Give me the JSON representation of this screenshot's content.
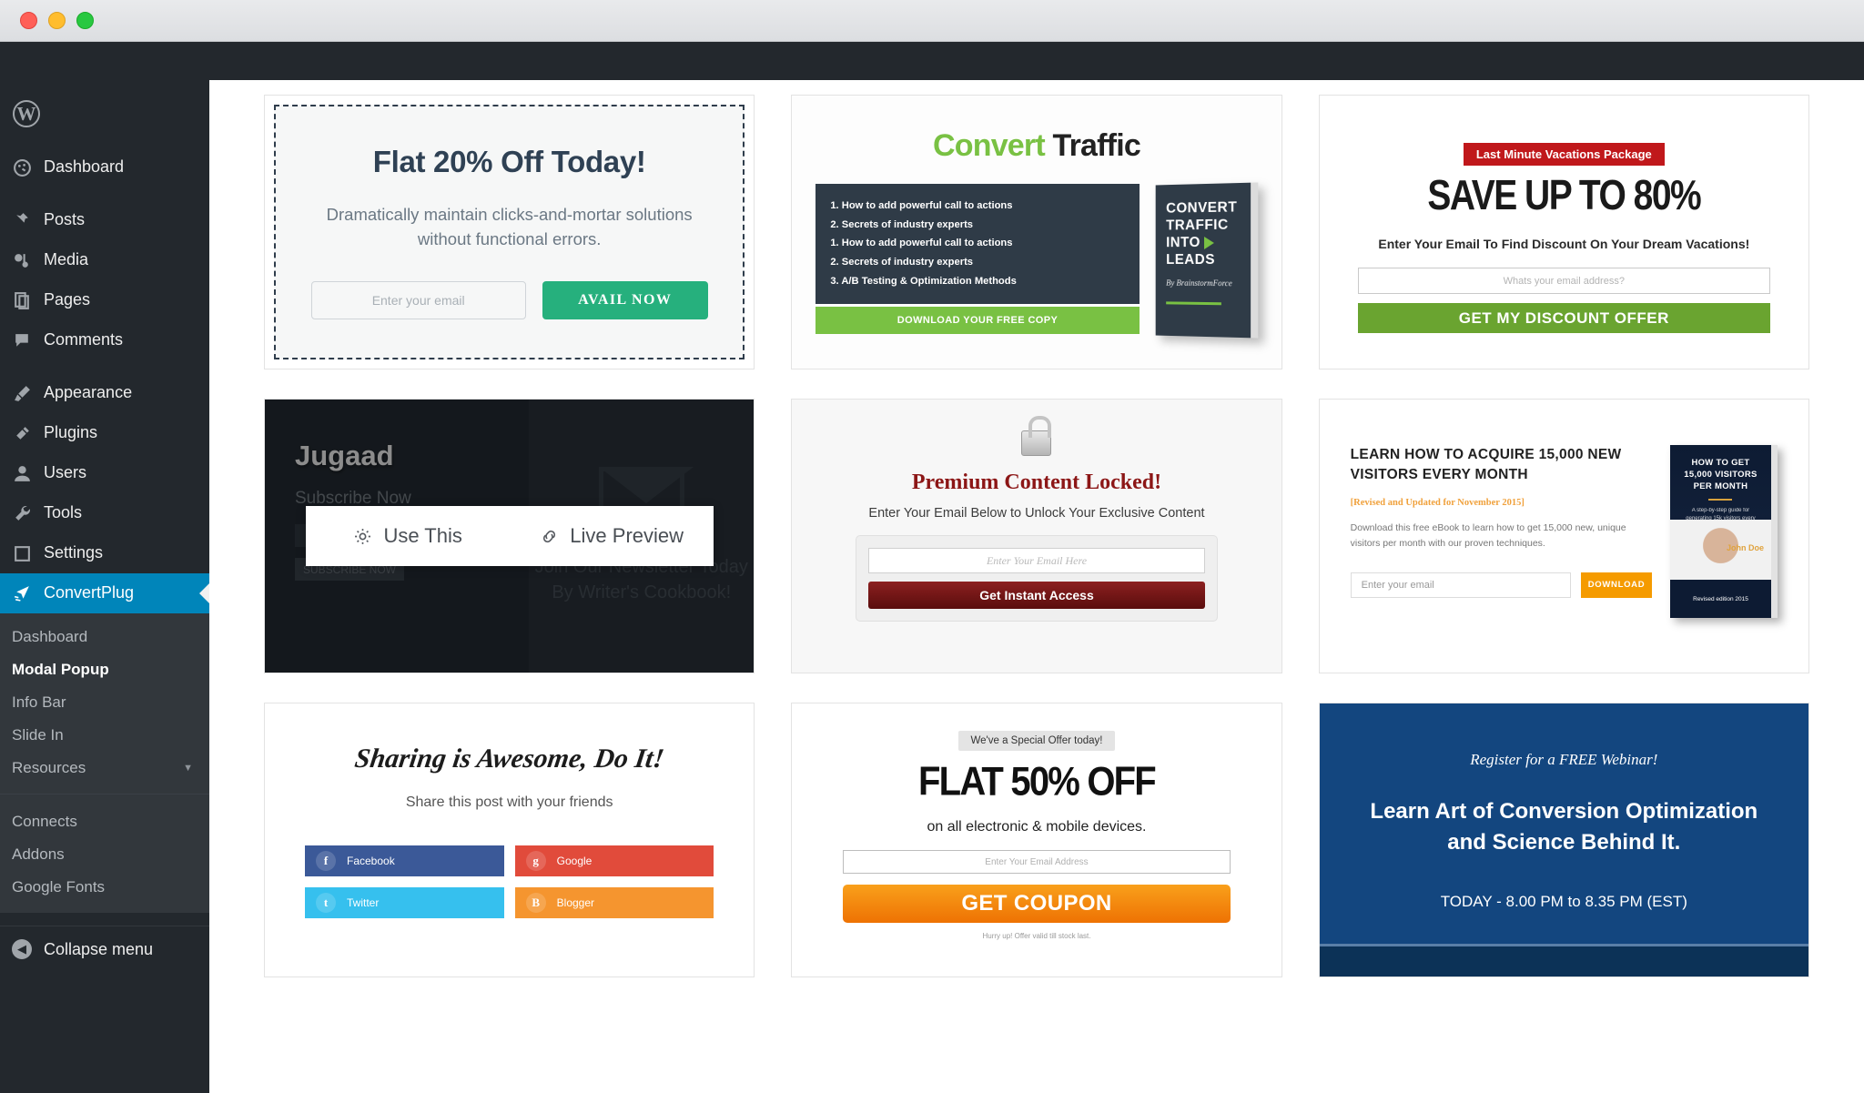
{
  "window": {
    "title": ""
  },
  "sidebar": {
    "logo": "W",
    "items": [
      {
        "label": "Dashboard",
        "icon": "dashboard-icon"
      },
      {
        "label": "Posts",
        "icon": "pin-icon"
      },
      {
        "label": "Media",
        "icon": "media-icon"
      },
      {
        "label": "Pages",
        "icon": "pages-icon"
      },
      {
        "label": "Comments",
        "icon": "comments-icon"
      },
      {
        "label": "Appearance",
        "icon": "brush-icon"
      },
      {
        "label": "Plugins",
        "icon": "plug-icon"
      },
      {
        "label": "Users",
        "icon": "user-icon"
      },
      {
        "label": "Tools",
        "icon": "wrench-icon"
      },
      {
        "label": "Settings",
        "icon": "settings-icon"
      },
      {
        "label": "ConvertPlug",
        "icon": "convertplug-icon"
      }
    ],
    "submenu": [
      {
        "label": "Dashboard",
        "current": false
      },
      {
        "label": "Modal Popup",
        "current": true
      },
      {
        "label": "Info Bar",
        "current": false
      },
      {
        "label": "Slide In",
        "current": false
      },
      {
        "label": "Resources",
        "current": false,
        "caret": "▼"
      }
    ],
    "submenu2": [
      {
        "label": "Connects"
      },
      {
        "label": "Addons"
      },
      {
        "label": "Google Fonts"
      }
    ],
    "collapse": {
      "label": "Collapse menu",
      "icon": "collapse-icon",
      "glyph": "◀"
    },
    "accent_color": "#0085ba",
    "bg_color": "#23282d",
    "submenu_bg": "#32373c"
  },
  "overlay": {
    "use_this": "Use This",
    "live_preview": "Live Preview",
    "use_this_icon": "gear-icon",
    "live_preview_icon": "link-icon"
  },
  "templates": {
    "flat20": {
      "title": "Flat 20% Off Today!",
      "body": "Dramatically maintain clicks-and-mortar solutions without functional errors.",
      "input_placeholder": "Enter your email",
      "button": "AVAIL NOW",
      "button_color": "#26b07d",
      "title_color": "#2f4154"
    },
    "convert": {
      "title_green": "Convert",
      "title_dark": " Traffic",
      "list": [
        "1. How to add powerful call to actions",
        "2. Secrets of industry experts",
        "1. How to add powerful call to actions",
        "2. Secrets of industry experts",
        "3. A/B Testing & Optimization Methods"
      ],
      "download": "DOWNLOAD YOUR FREE COPY",
      "book_line1": "CONVERT",
      "book_line2": "TRAFFIC",
      "book_line3": "INTO",
      "book_line4": "LEADS",
      "book_author": "By BrainstormForce",
      "accent": "#79c143"
    },
    "save80": {
      "badge": "Last Minute Vacations Package",
      "title": "SAVE UP TO 80%",
      "subtitle": "Enter Your Email To Find Discount On Your Dream Vacations!",
      "input_placeholder": "Whats your email address?",
      "button": "GET MY DISCOUNT OFFER",
      "badge_color": "#c0181b",
      "button_color": "#6aa430"
    },
    "jugaad": {
      "brand": "Jugaad",
      "subscribe": "Subscribe Now",
      "button": "SUBSCRIBE NOW",
      "tagline": "Join Our Newsletter Today By Writer's Cookbook!",
      "envelope_icon": "envelope-icon"
    },
    "locked": {
      "lock_icon": "padlock-icon",
      "title": "Premium Content Locked!",
      "subtitle": "Enter Your Email Below to Unlock Your Exclusive Content",
      "input_placeholder": "Enter Your Email Here",
      "button": "Get Instant Access",
      "title_color": "#8c1616"
    },
    "acquire": {
      "title": "LEARN HOW TO ACQUIRE 15,000 NEW VISITORS EVERY MONTH",
      "revised": "[Revised and Updated for November 2015]",
      "description": "Download this free eBook to learn how to get 15,000 new, unique visitors per month with our proven techniques.",
      "input_placeholder": "Enter your email",
      "button": "DOWNLOAD",
      "book_title": "HOW TO GET 15,000 VISITORS PER MONTH",
      "book_sub": "A step-by-step guide for generating 15k visitors every month.",
      "book_author": "John Doe",
      "book_edition": "Revised edition 2015",
      "button_color": "#f59b00"
    },
    "share": {
      "title": "Sharing is Awesome, Do It!",
      "subtitle": "Share this post with your friends",
      "buttons": [
        {
          "label": "Facebook",
          "glyph": "f",
          "color": "#3b5998"
        },
        {
          "label": "Google",
          "glyph": "g",
          "color": "#e14b3b"
        },
        {
          "label": "Twitter",
          "glyph": "t",
          "color": "#36c0ee"
        },
        {
          "label": "Blogger",
          "glyph": "B",
          "color": "#f5952f"
        }
      ]
    },
    "flat50": {
      "badge": "We've a Special Offer today!",
      "title": "FLAT 50% OFF",
      "subtitle": "on all electronic & mobile devices.",
      "input_placeholder": "Enter Your Email Address",
      "button": "GET COUPON",
      "note": "Hurry up! Offer valid till stock last.",
      "button_color": "#ee7203"
    },
    "webinar": {
      "register": "Register for a FREE Webinar!",
      "title": "Learn Art of Conversion Optimization and Science Behind It.",
      "time": "TODAY - 8.00 PM to 8.35 PM (EST)",
      "bg_color": "#13467f"
    }
  }
}
